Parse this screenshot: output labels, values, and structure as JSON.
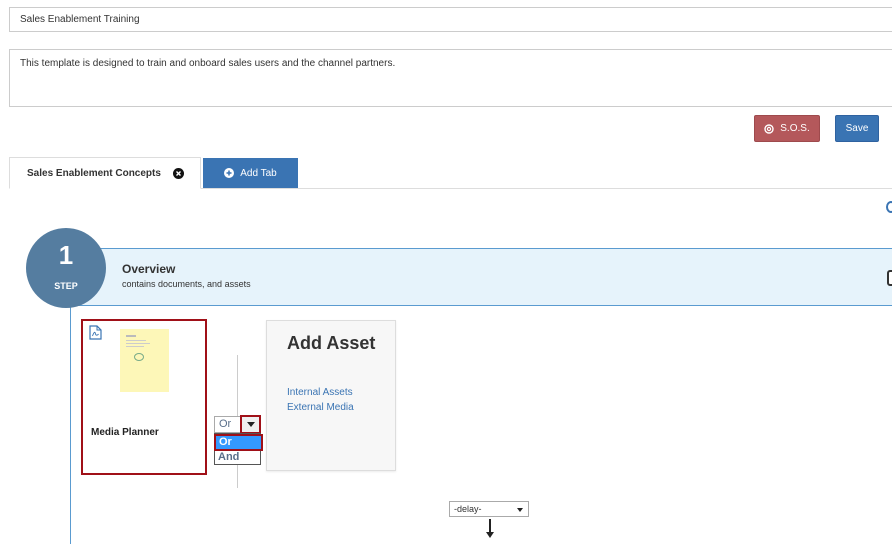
{
  "template": {
    "name": "Sales Enablement Training",
    "description": "This template is designed to train and onboard sales users and the channel partners."
  },
  "actions": {
    "sos_label": "S.O.S.",
    "sos_icon": "lifebuoy-icon",
    "save_label": "Save"
  },
  "tabs": {
    "active_label": "Sales Enablement Concepts",
    "active_close_icon": "close-circle-icon",
    "add_label": "Add Tab",
    "add_icon": "plus-circle-icon"
  },
  "step": {
    "number": "1",
    "step_word": "STEP",
    "title": "Overview",
    "subtitle": "contains documents, and assets"
  },
  "asset": {
    "name": "Media Planner",
    "file_icon": "pdf-file-icon"
  },
  "logic": {
    "selected": "Or",
    "options": [
      "Or",
      "And"
    ]
  },
  "add_asset": {
    "title": "Add Asset",
    "links": [
      "Internal Assets",
      "External Media"
    ]
  },
  "delay": {
    "selected": "-delay-"
  },
  "colors": {
    "primary": "#3a74b3",
    "sos": "#b4585b",
    "step_circle": "#557da0",
    "step_band": "#e6f3fb",
    "highlight_border": "#a01018",
    "option_selected": "#3399ff"
  }
}
